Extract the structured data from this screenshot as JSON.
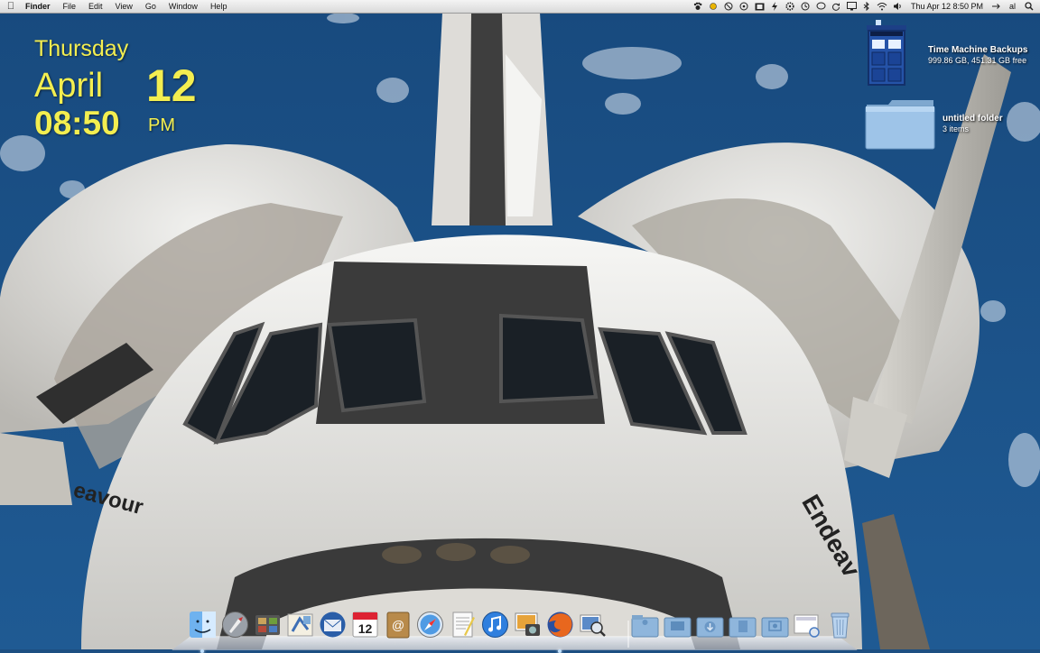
{
  "menubar": {
    "apple_icon": "apple-icon",
    "app_name": "Finder",
    "menus": [
      "File",
      "Edit",
      "View",
      "Go",
      "Window",
      "Help"
    ],
    "status_icons": [
      "paw-icon",
      "sun-icon",
      "timer-icon",
      "steering-icon",
      "film-icon",
      "bolt-icon",
      "gear-icon",
      "time-machine-icon",
      "chat-icon",
      "sync-icon",
      "monitor-icon",
      "bluetooth-icon",
      "wifi-icon",
      "volume-icon"
    ],
    "clock": "Thu Apr 12  8:50 PM",
    "user": "al",
    "spotlight_icon": "spotlight-icon"
  },
  "clock_widget": {
    "day": "Thursday",
    "month": "April",
    "date": "12",
    "time": "08:50",
    "ampm": "PM"
  },
  "desktop_icons": [
    {
      "label": "Time Machine Backups",
      "sub": "999.86 GB, 451.31 GB free",
      "icon": "tardis-drive-icon"
    },
    {
      "label": "untitled folder",
      "sub": "3 items",
      "icon": "folder-icon"
    }
  ],
  "dock": {
    "apps": [
      "finder-icon",
      "launchpad-icon",
      "photo-booth-icon",
      "mail-icon",
      "thunderbird-icon",
      "calendar-icon",
      "address-book-icon",
      "safari-icon",
      "textedit-icon",
      "itunes-icon",
      "iphoto-icon",
      "firefox-icon",
      "preview-icon"
    ],
    "calendar_date": "12",
    "others": [
      "applications-stack-icon",
      "desktop-stack-icon",
      "downloads-stack-icon",
      "documents-stack-icon",
      "pictures-stack-icon",
      "screenshot-stack-icon",
      "trash-icon"
    ]
  },
  "colors": {
    "clock_yellow": "#f3ee50",
    "ocean": "#1d4f82"
  }
}
